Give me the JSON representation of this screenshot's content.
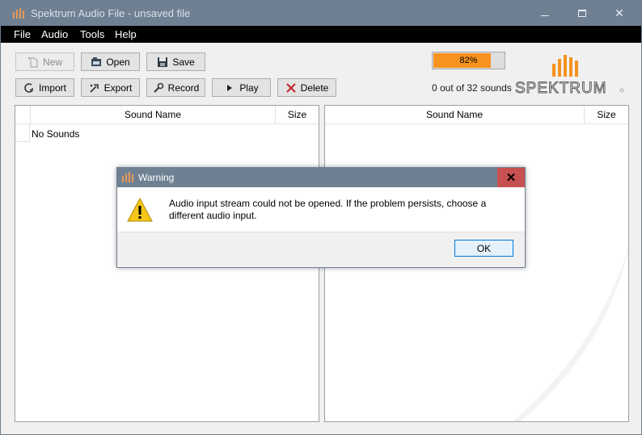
{
  "window": {
    "title": "Spektrum Audio File - unsaved file",
    "minimize": "minimize",
    "maximize": "maximize",
    "close": "✕"
  },
  "menu": [
    "File",
    "Audio",
    "Tools",
    "Help"
  ],
  "toolbar": {
    "new_label": "New",
    "open_label": "Open",
    "save_label": "Save",
    "import_label": "Import",
    "export_label": "Export",
    "record_label": "Record",
    "play_label": "Play",
    "delete_label": "Delete"
  },
  "progress": {
    "value": 82,
    "label": "82%"
  },
  "sound_count": "0 out of 32 sounds",
  "logo": {
    "text": "SPEKTRUM",
    "color": "#f6921e"
  },
  "left_table": {
    "columns": [
      "Sound Name",
      "Size"
    ],
    "empty_text": "No Sounds"
  },
  "right_table": {
    "columns": [
      "Sound Name",
      "Size"
    ]
  },
  "dialog": {
    "title": "Warning",
    "close": "✕",
    "icon": "warning-icon",
    "message": "Audio input stream could not be opened. If the problem persists, choose a different audio input.",
    "ok_label": "OK"
  },
  "colors": {
    "titlebar": "#6f8093",
    "accent": "#f6921e",
    "dialog_close": "#c75050"
  }
}
